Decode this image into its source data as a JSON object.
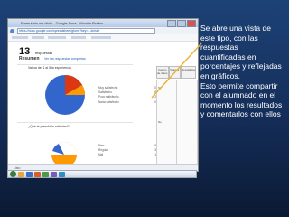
{
  "browser": {
    "title": "Formulario sin título - Google Docs - Mozilla Firefox",
    "url": "https://docs.google.com/spreadsheet/gform?key=...#chart",
    "status": "Listo"
  },
  "survey": {
    "responses_count": "13",
    "responses_label": "respuestas",
    "summary_title": "Resumen",
    "summary_link": "Ver las respuestas completas",
    "questions": [
      {
        "title": "Valora del 1 al 5 la experiencia",
        "legend": [
          {
            "label": "Muy satisfecho",
            "value": "10"
          },
          {
            "label": "Satisfecho",
            "value": "8"
          },
          {
            "label": "Poco satisfecho",
            "value": "2"
          },
          {
            "label": "Nada satisfecho",
            "value": "0"
          }
        ]
      },
      {
        "title": "¿Qué te pareció la actividad?",
        "legend": [
          {
            "label": "Bien",
            "value": "9"
          },
          {
            "label": "Regular",
            "value": "3"
          },
          {
            "label": "Mal",
            "value": "1"
          }
        ]
      }
    ],
    "side_headers": [
      "Campo de datos",
      "Valores",
      "Resultados"
    ],
    "side_tags": [
      "Sí",
      "No"
    ]
  },
  "colors": {
    "slide_background": "#1a3a6e",
    "pie_blue": "#3366cc",
    "pie_orange": "#ff9900",
    "pie_red": "#dc3912",
    "pie_green": "#109618",
    "callout_line": "#f0b030"
  },
  "caption": {
    "lines": [
      "Se abre una vista de",
      "este tipo, con las",
      "respuestas",
      "cuantificadas en",
      "porcentajes y reflejadas",
      "en gráficos.",
      "Esto permite compartir",
      "con el alumnado en el",
      "momento los resultados",
      "y comentarlos con ellos"
    ]
  }
}
